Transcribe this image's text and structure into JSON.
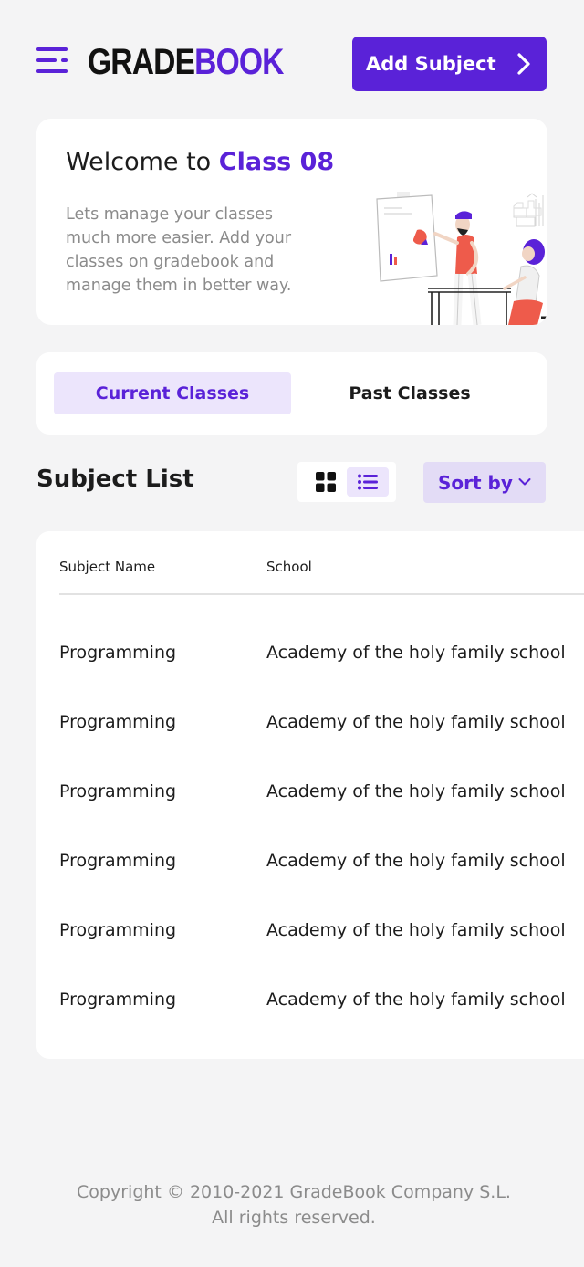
{
  "header": {
    "logo_primary": "GRADE",
    "logo_accent": "BOOK",
    "add_button_label": "Add Subject"
  },
  "welcome": {
    "title_prefix": "Welcome to",
    "class_name": "Class 08",
    "description": "Lets manage your classes much more easier. Add your classes on gradebook and manage them in better way."
  },
  "tabs": [
    {
      "label": "Current Classes",
      "active": true
    },
    {
      "label": "Past Classes",
      "active": false
    }
  ],
  "subject_list": {
    "title": "Subject List",
    "view_modes": [
      "grid-view-icon",
      "list-view-icon"
    ],
    "active_view": "list",
    "sort_label": "Sort by",
    "columns": [
      "Subject Name",
      "School"
    ],
    "rows": [
      {
        "subject": "Programming",
        "school": "Academy of the holy family school"
      },
      {
        "subject": "Programming",
        "school": "Academy of the holy family school"
      },
      {
        "subject": "Programming",
        "school": "Academy of the holy family school"
      },
      {
        "subject": "Programming",
        "school": "Academy of the holy family school"
      },
      {
        "subject": "Programming",
        "school": "Academy of the holy family school"
      },
      {
        "subject": "Programming",
        "school": "Academy of the holy family school"
      }
    ]
  },
  "footer": {
    "copyright": "Copyright © 2010-2021 GradeBook Company S.L. All rights reserved."
  },
  "colors": {
    "accent": "#5a22d8",
    "accent_light": "#ece5fc",
    "background": "#f4f4f5"
  }
}
